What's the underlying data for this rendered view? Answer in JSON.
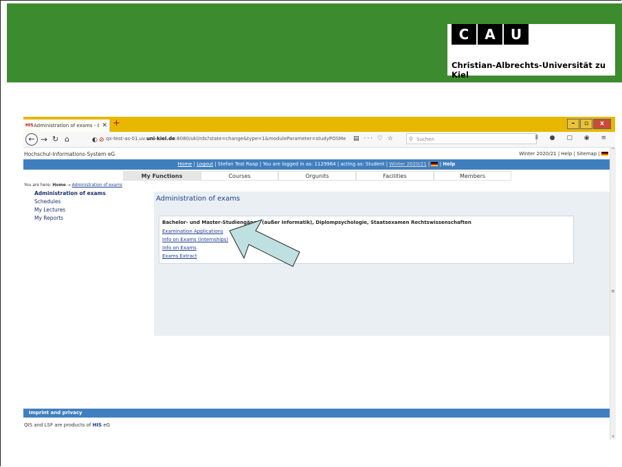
{
  "logo": {
    "letters": [
      "C",
      "A",
      "U"
    ],
    "name": "Christian-Albrechts-Universität zu Kiel"
  },
  "browser": {
    "tab_title": "Administration of exams - Chr…",
    "tab_close": "✕",
    "new_tab": "+",
    "url_prefix": "qx-test-as-01.uv.",
    "url_host": "uni-kiel.de",
    "url_rest": ":8080/ukl/rds?state=change&type=1&moduleParameter=studyPOSMe",
    "search_placeholder": "Suchen",
    "window_controls": [
      "–",
      "▫",
      "x"
    ]
  },
  "site": {
    "name": "Hochschul-Informations-System eG",
    "top_links": "Winter 2020/21 | Help | Sitemap |"
  },
  "bluebar": {
    "home": "Home",
    "logout": "Logout",
    "user": "Stefan Test Raap",
    "logged_in": "You are logged in as:",
    "id": "1129964",
    "acting": "acting as: Student",
    "semester": "Winter 2020/21",
    "help": "Help"
  },
  "tabs": [
    "My Functions",
    "Courses",
    "Orgunits",
    "Facilities",
    "Members"
  ],
  "breadcrumb": {
    "prefix": "You are here:",
    "home": "Home",
    "current": "Administration of exams"
  },
  "sidebar": [
    "Administration of exams",
    "Schedules",
    "My Lectures",
    "My Reports"
  ],
  "main": {
    "title": "Administration of exams",
    "box_heading": "Bachelor- und Master-Studiengänge (außer Informatik), Diplompsychologie, Staatsexamen Rechtswissenschaften",
    "links": [
      "Examination Applications",
      "Info on Exams (internships)",
      "Info on Exams",
      "Exams Extract"
    ]
  },
  "footer": {
    "bar": "Imprint and privacy",
    "text_prefix": "QIS and LSF are products of",
    "text_brand": "HIS",
    "text_suffix": "eG"
  },
  "colors": {
    "green": "#3d8b2f",
    "blue": "#3f7fbf",
    "arrow_fill": "#bfe0e0"
  }
}
